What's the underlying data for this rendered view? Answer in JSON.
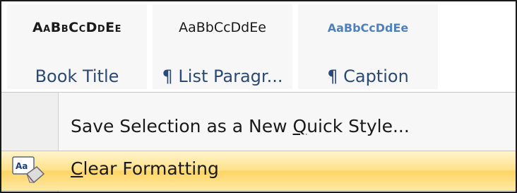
{
  "style_gallery": {
    "items": [
      {
        "preview": "AaBbCcDdEe",
        "name": "Book Title"
      },
      {
        "preview": "AaBbCcDdEe",
        "name": "¶ List Paragr..."
      },
      {
        "preview": "AaBbCcDdEe",
        "name": "¶ Caption"
      }
    ]
  },
  "menu": {
    "save_quick_style": {
      "label_before": "Save Selection as a New ",
      "label_accel": "Q",
      "label_after": "uick Style..."
    },
    "clear_formatting": {
      "label_accel": "C",
      "label_after": "lear Formatting",
      "icon": "clear-formatting-icon"
    }
  },
  "colors": {
    "style_name": "#2b4a76",
    "caption_preview": "#4f81bd",
    "highlight": "#ffe18a"
  }
}
